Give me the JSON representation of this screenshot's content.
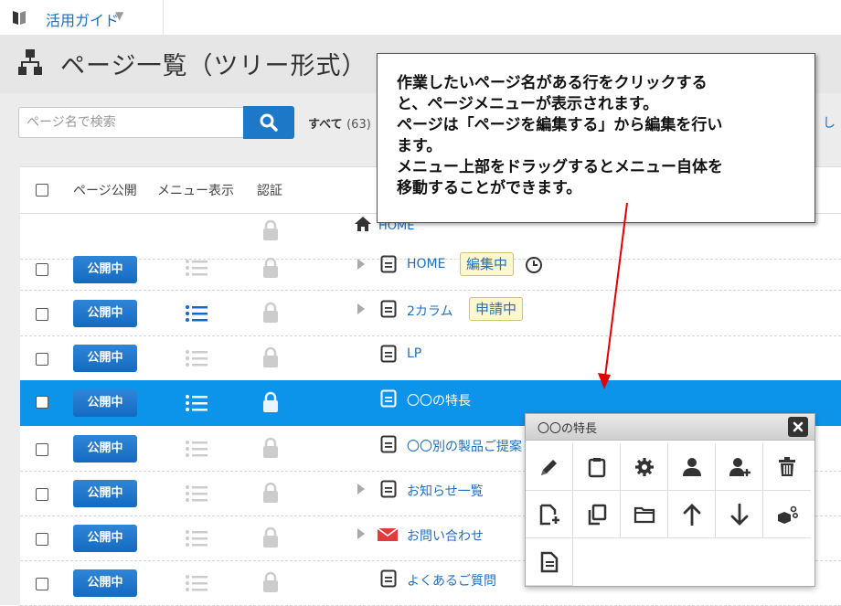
{
  "topbar": {
    "guide_label": "活用ガイド",
    "caret": "▼"
  },
  "header": {
    "title": "ページ一覧（ツリー形式）"
  },
  "search": {
    "placeholder": "ページ名で検索",
    "all_label": "すべて",
    "all_count": "(63)",
    "right_link": "し"
  },
  "table": {
    "columns": {
      "publish": "ページ公開",
      "menu": "メニュー表示",
      "auth": "認証"
    },
    "rows": [
      {
        "name": "HOME",
        "type": "home"
      },
      {
        "name": "HOME",
        "publish": "公開中",
        "badge": "編集中",
        "type": "doc",
        "expandable": true
      },
      {
        "name": "2カラム",
        "publish": "公開中",
        "badge": "申請中",
        "type": "doc",
        "expandable": true
      },
      {
        "name": "LP",
        "publish": "公開中",
        "type": "doc"
      },
      {
        "name": "〇〇の特長",
        "publish": "公開中",
        "type": "doc",
        "selected": true
      },
      {
        "name": "〇〇別の製品ご提案",
        "publish": "公開中",
        "type": "doc"
      },
      {
        "name": "お知らせ一覧",
        "publish": "公開中",
        "type": "doc",
        "expandable": true
      },
      {
        "name": "お問い合わせ",
        "publish": "公開中",
        "type": "mail",
        "expandable": true
      },
      {
        "name": "よくあるご質問",
        "publish": "公開中",
        "type": "doc"
      }
    ]
  },
  "callout": {
    "lines": [
      "作業したいページ名がある行をクリックする",
      "と、ページメニューが表示されます。",
      "ページは「ページを編集する」から編集を行い",
      "ます。",
      "メニュー上部をドラッグするとメニュー自体を",
      "移動することができます。"
    ]
  },
  "page_menu": {
    "title": "〇〇の特長",
    "icons": [
      "pencil-icon",
      "clipboard-icon",
      "gear-icon",
      "sitemap-icon",
      "user-plus-icon",
      "trash-icon",
      "new-page-icon",
      "copy-icon",
      "folder-icon",
      "arrow-up-icon",
      "arrow-down-icon",
      "cubes-icon",
      "document-icon"
    ]
  },
  "colors": {
    "accent": "#1e78c8",
    "selected_row": "#0c94ea",
    "badge_bg": "#fff8cc",
    "arrow": "#e00000"
  }
}
